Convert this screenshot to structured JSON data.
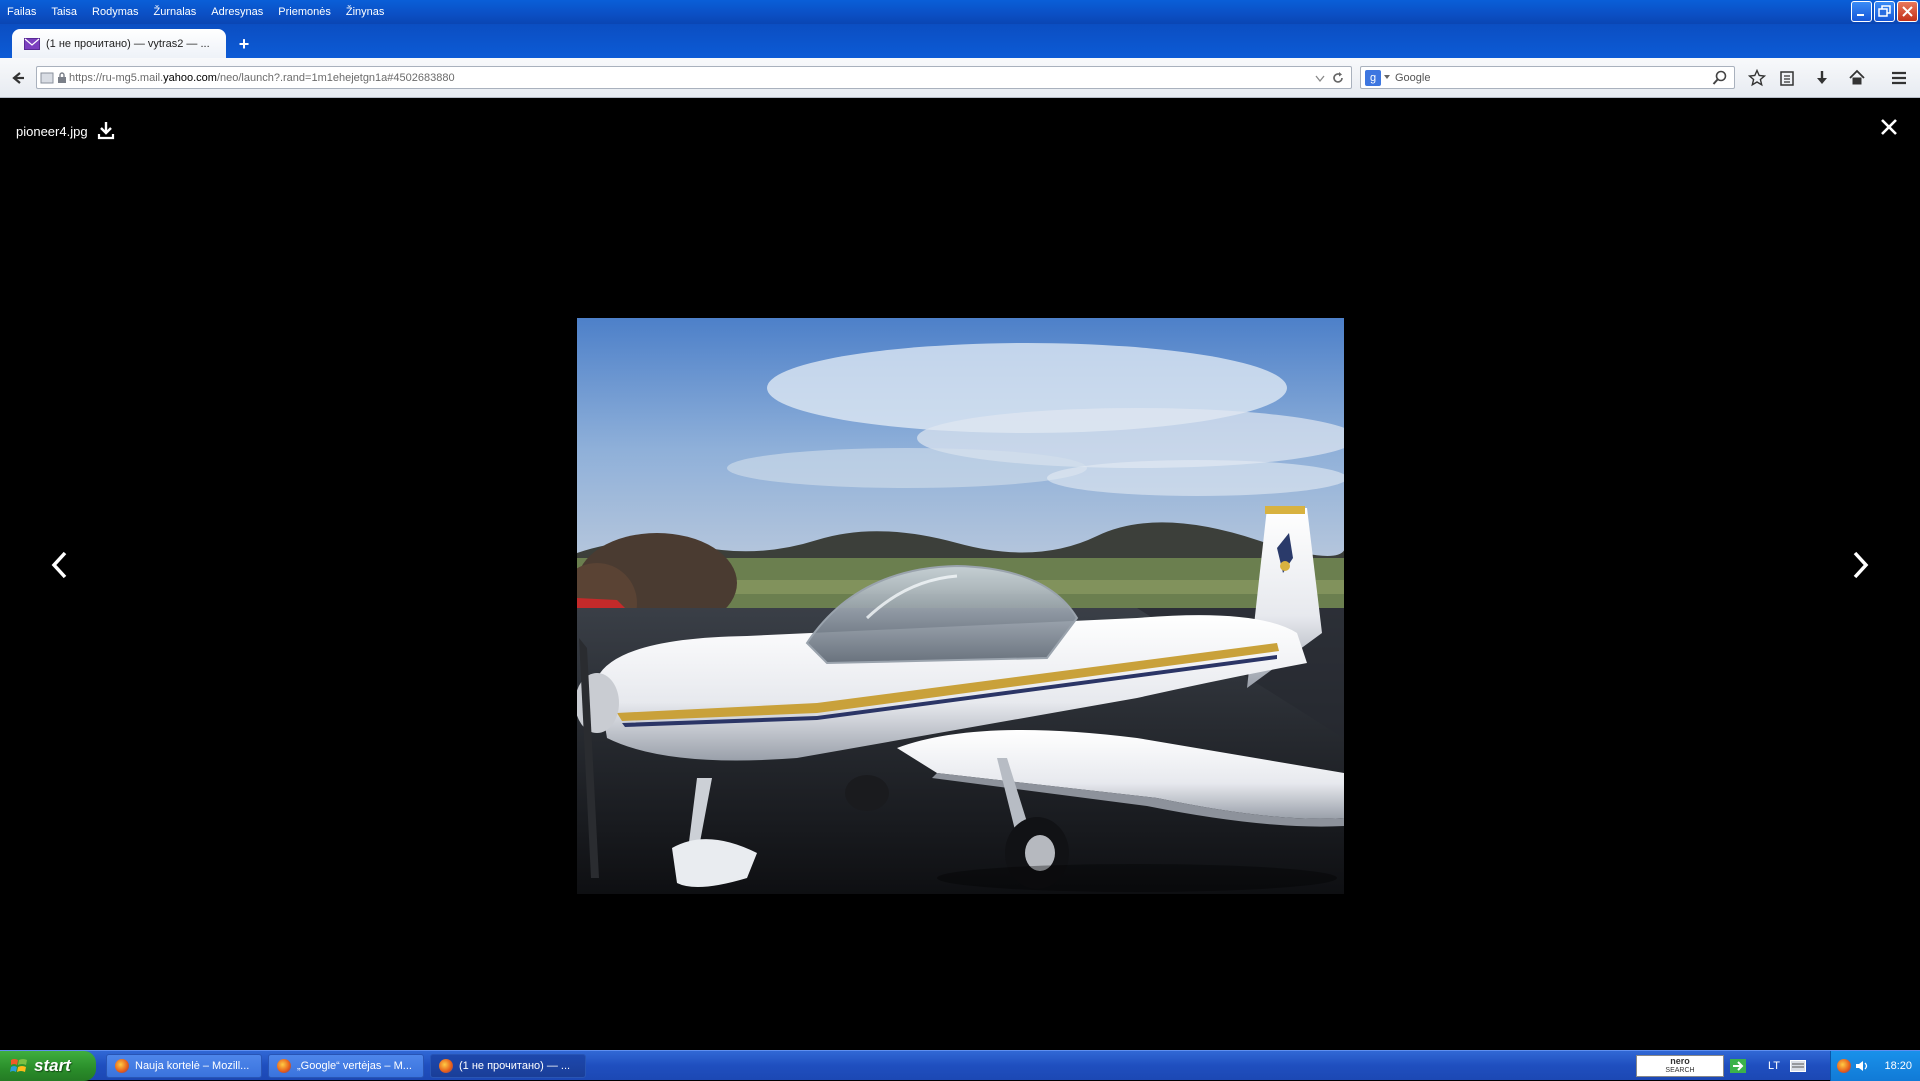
{
  "menu": {
    "items": [
      "Failas",
      "Taisa",
      "Rodymas",
      "Žurnalas",
      "Adresynas",
      "Priemonės",
      "Žinynas"
    ]
  },
  "tab": {
    "title": "(1 не прочитано) — vytras2 — ...",
    "new_tab_label": "+"
  },
  "address_bar": {
    "url_prefix": "https://ru-mg5.mail.",
    "url_domain": "yahoo.com",
    "url_suffix": "/neo/launch?.rand=1m1ehejetgn1a#4502683880"
  },
  "search_bar": {
    "engine_badge": "g",
    "placeholder": "Google"
  },
  "viewer": {
    "filename": "pioneer4.jpg",
    "photo_subject": "white light aircraft on tarmac"
  },
  "taskbar": {
    "start_label": "start",
    "tasks": [
      {
        "label": "Nauja kortelė – Mozill..."
      },
      {
        "label": "„Google“ vertėjas – M..."
      },
      {
        "label": "(1 не прочитано) — ..."
      }
    ],
    "nero_label": "nero",
    "nero_sub": "SEARCH",
    "language": "LT",
    "clock": "18:20"
  }
}
